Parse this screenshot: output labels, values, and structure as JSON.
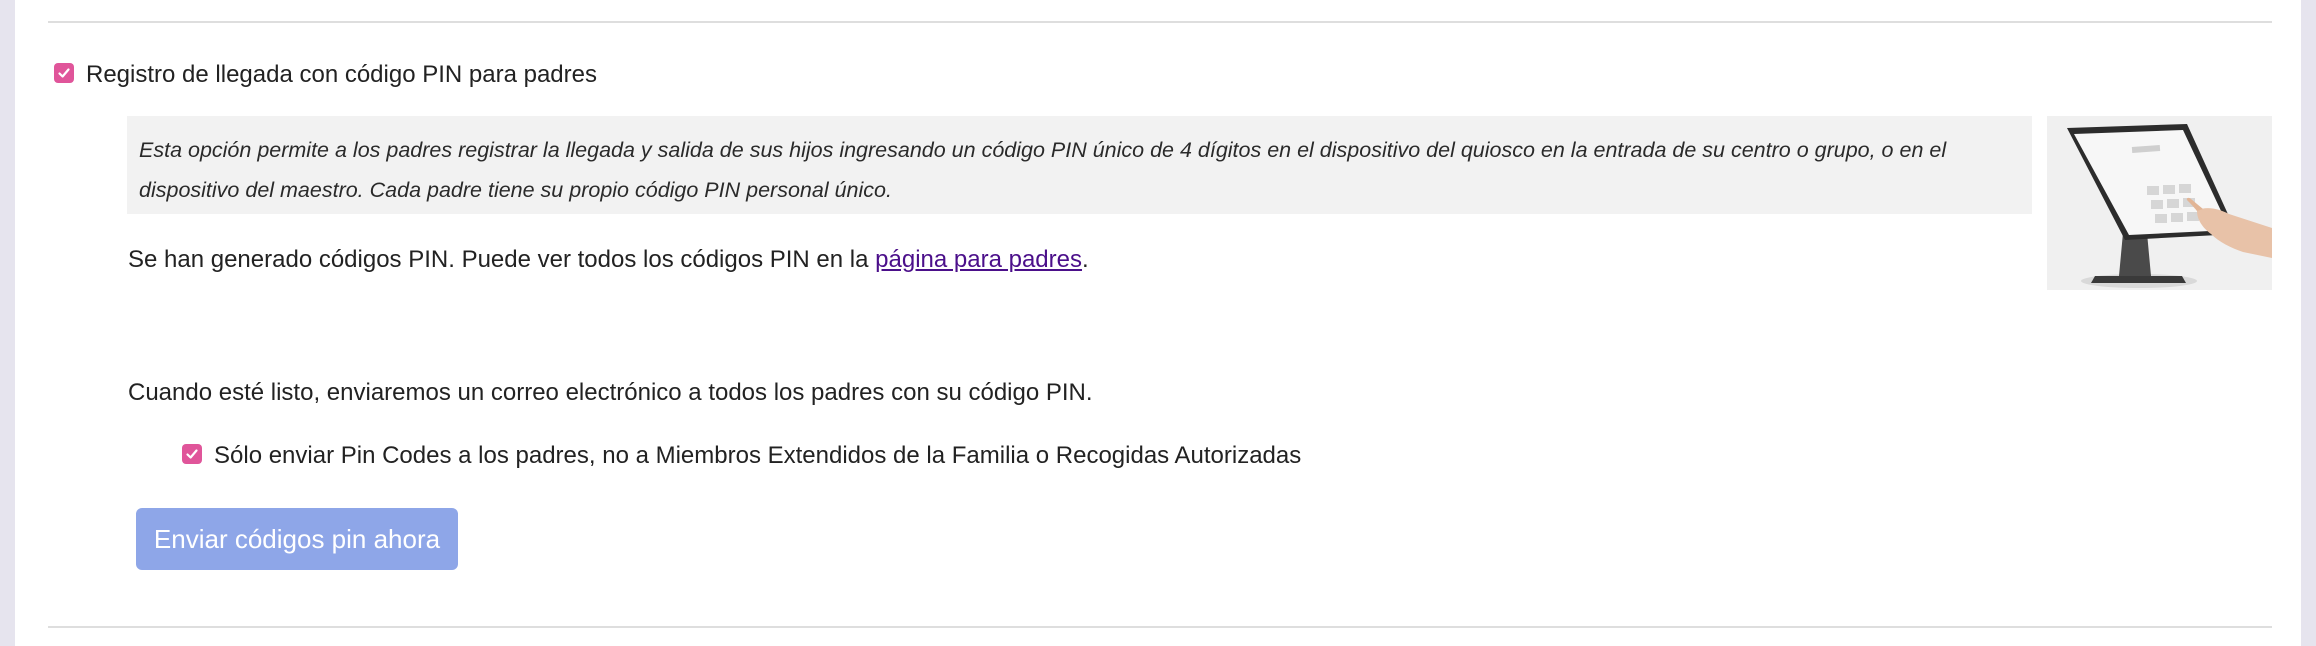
{
  "pin_checkin": {
    "enabled": true,
    "label": "Registro de llegada con código PIN para padres",
    "description": "Esta opción permite a los padres registrar la llegada y salida de sus hijos ingresando un código PIN único de 4 dígitos en el dispositivo del quiosco en la entrada de su centro o grupo, o en el dispositivo del maestro. Cada padre tiene su propio código PIN personal único.",
    "kiosk_image_icon": "pin-kiosk-tablet-icon",
    "generated_text": "Se han generado códigos PIN. Puede ver todos los códigos PIN en la",
    "parents_page_link": "página para padres",
    "generated_suffix": ".",
    "email_notice": "Cuando esté listo, enviaremos un correo electrónico a todos los padres con su código PIN.",
    "parents_only": {
      "checked": true,
      "label": "Sólo enviar Pin Codes a los padres, no a Miembros Extendidos de la Familia o Recogidas Autorizadas"
    },
    "send_button_label": "Enviar códigos pin ahora"
  },
  "colors": {
    "checkbox_accent": "#e0559a",
    "button_bg": "#8ea6e8",
    "link": "#4b0f8a",
    "info_bg": "#f2f2f2"
  }
}
